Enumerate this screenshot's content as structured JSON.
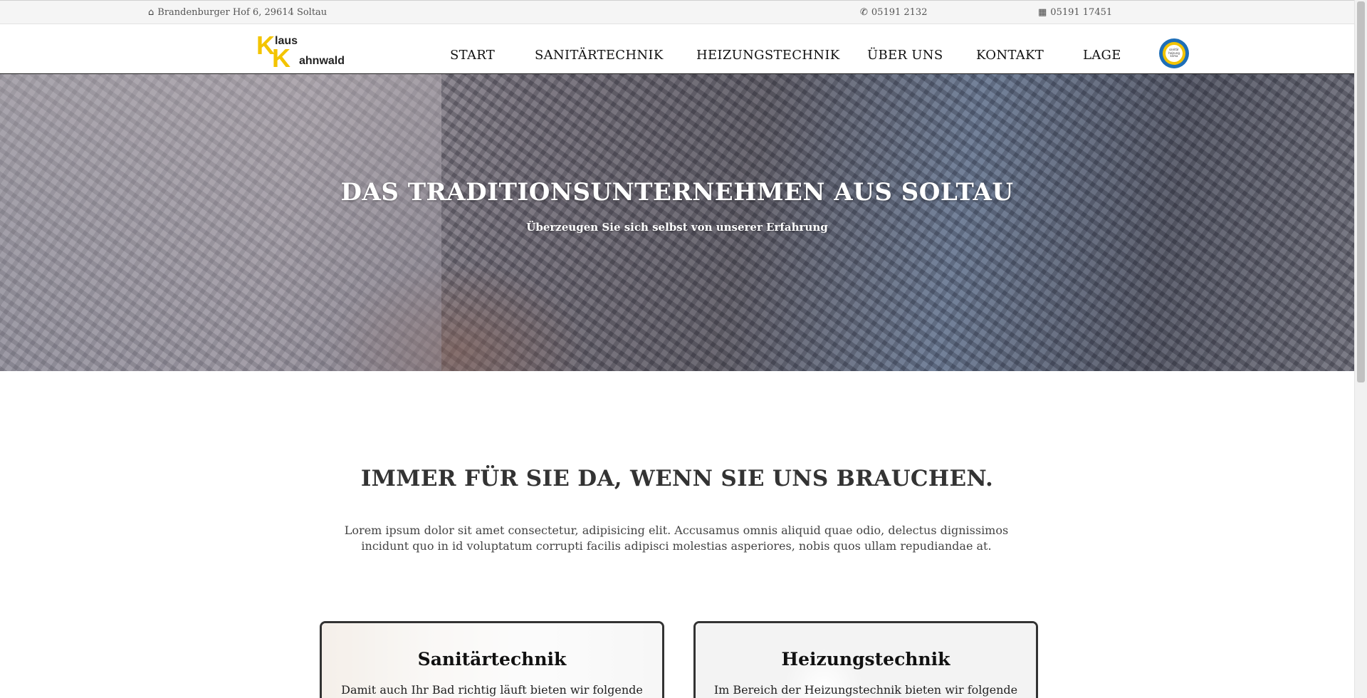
{
  "topbar": {
    "address_icon": "home-icon",
    "address": "Brandenburger Hof 6, 29614 Soltau",
    "phone_icon": "phone-icon",
    "phone": "05191 2132",
    "fax_icon": "fax-icon",
    "fax": "05191 17451"
  },
  "logo": {
    "k1": "K",
    "word1": "laus",
    "k2": "K",
    "word2": "ahnwald",
    "accent_color": "#f3c400"
  },
  "nav": {
    "items": [
      "START",
      "SANITÄRTECHNIK",
      "HEIZUNGSTECHNIK",
      "ÜBER UNS",
      "KONTAKT",
      "LAGE"
    ],
    "badge_text": "sanitär heizung klima"
  },
  "hero": {
    "title": "DAS TRADITIONSUNTERNEHMEN AUS SOLTAU",
    "subtitle": "Überzeugen Sie sich selbst von unserer Erfahrung"
  },
  "intro": {
    "headline": "IMMER FÜR SIE DA, WENN SIE UNS BRAUCHEN.",
    "text": "Lorem ipsum dolor sit amet consectetur, adipisicing elit. Accusamus omnis aliquid quae odio, delectus dignissimos incidunt quo in id voluptatum corrupti facilis adipisci molestias asperiores, nobis quos ullam repudiandae at."
  },
  "cards": [
    {
      "title": "Sanitärtechnik",
      "text": "Damit auch Ihr Bad richtig läuft bieten wir folgende"
    },
    {
      "title": "Heizungstechnik",
      "text": "Im Bereich der Heizungstechnik bieten wir folgende"
    }
  ]
}
